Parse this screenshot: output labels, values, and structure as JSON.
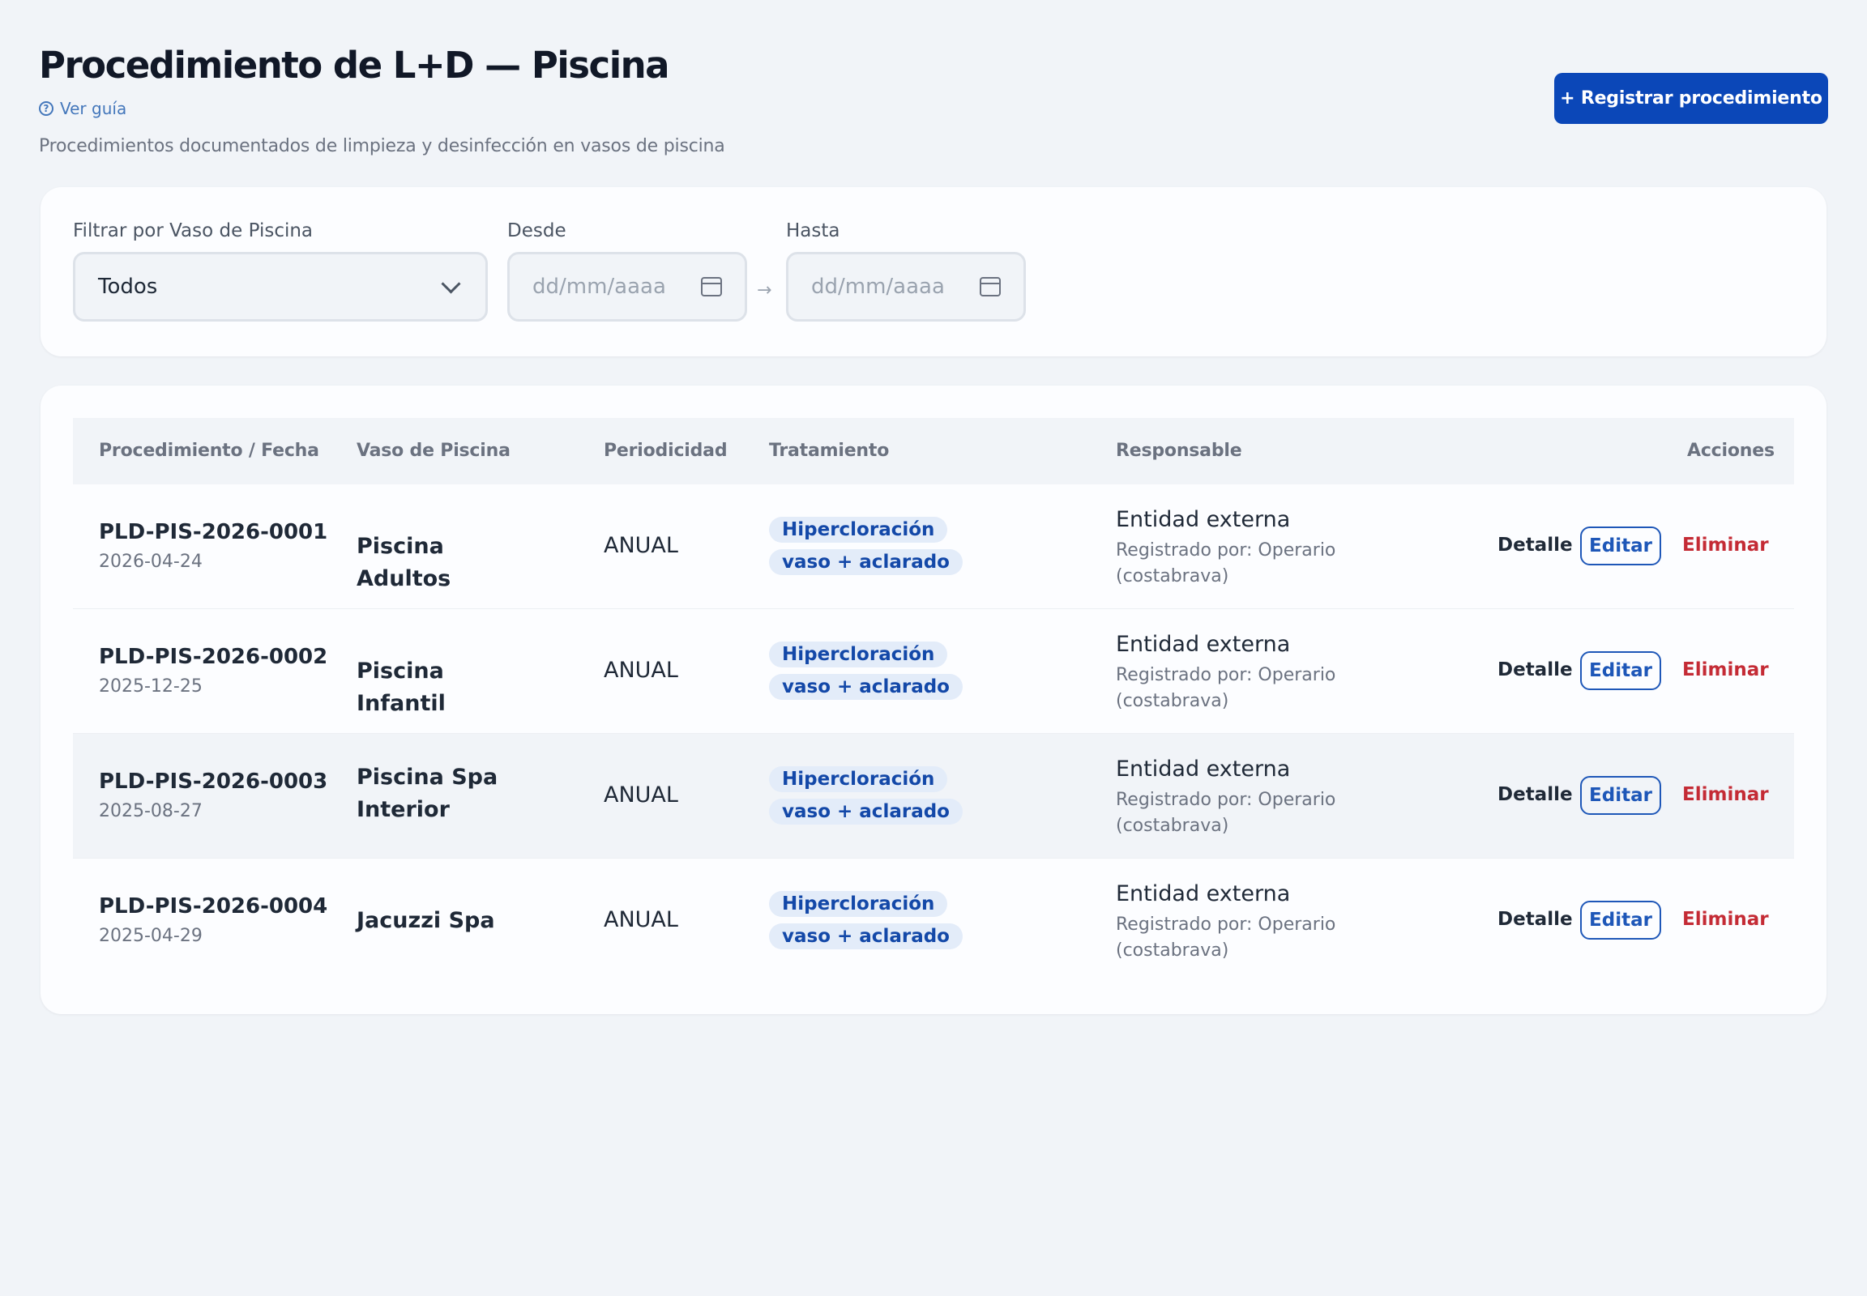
{
  "header": {
    "title": "Procedimiento de L+D — Piscina",
    "guide_label": "Ver guía",
    "subtitle": "Procedimientos documentados de limpieza y desinfección en vasos de piscina",
    "primary_button": "+ Registrar procedimiento"
  },
  "filters": {
    "vaso_label": "Filtrar por Vaso de Piscina",
    "vaso_value": "Todos",
    "desde_label": "Desde",
    "desde_placeholder": "dd/mm/aaaa",
    "hasta_label": "Hasta",
    "hasta_placeholder": "dd/mm/aaaa",
    "separator": "→"
  },
  "table": {
    "columns": [
      "Procedimiento / Fecha",
      "Vaso de Piscina",
      "Periodicidad",
      "Tratamiento",
      "Responsable",
      "Acciones"
    ],
    "actions": {
      "detalle": "Detalle",
      "editar": "Editar",
      "eliminar": "Eliminar"
    },
    "rows": [
      {
        "code": "PLD-PIS-2026-0001",
        "date": "2026-04-24",
        "vaso": "Piscina Adultos",
        "periodicidad": "ANUAL",
        "tratamiento": "Hipercloración vaso + aclarado",
        "responsable": "Entidad externa",
        "registrado": "Registrado por: Operario (costabrava)"
      },
      {
        "code": "PLD-PIS-2026-0002",
        "date": "2025-12-25",
        "vaso": "Piscina Infantil",
        "periodicidad": "ANUAL",
        "tratamiento": "Hipercloración vaso + aclarado",
        "responsable": "Entidad externa",
        "registrado": "Registrado por: Operario (costabrava)"
      },
      {
        "code": "PLD-PIS-2026-0003",
        "date": "2025-08-27",
        "vaso": "Piscina Spa Interior",
        "periodicidad": "ANUAL",
        "tratamiento": "Hipercloración vaso + aclarado",
        "responsable": "Entidad externa",
        "registrado": "Registrado por: Operario (costabrava)"
      },
      {
        "code": "PLD-PIS-2026-0004",
        "date": "2025-04-29",
        "vaso": "Jacuzzi Spa",
        "periodicidad": "ANUAL",
        "tratamiento": "Hipercloración vaso + aclarado",
        "responsable": "Entidad externa",
        "registrado": "Registrado por: Operario (costabrava)"
      }
    ]
  },
  "icons": {
    "guide": "help-circle-icon",
    "select": "chevron-down-icon",
    "date": "calendar-icon"
  },
  "colors": {
    "primary": "#0b47b8",
    "link": "#4477bb",
    "danger": "#c42b35",
    "badge_bg": "#e3ecf9",
    "background": "#f1f4f8"
  }
}
